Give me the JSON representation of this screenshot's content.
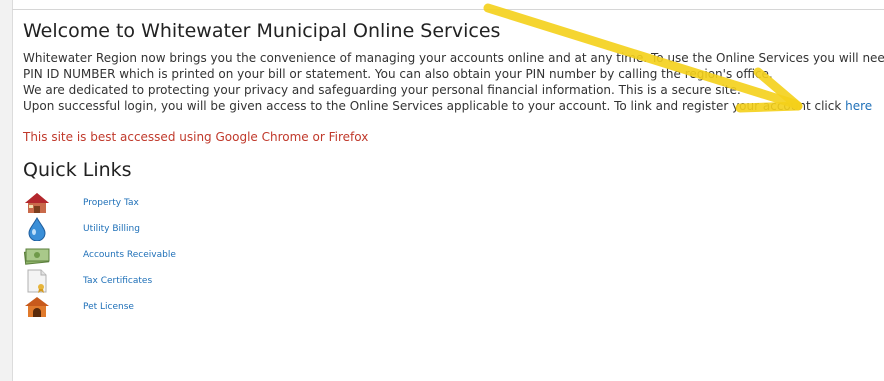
{
  "page": {
    "title": "Welcome to Whitewater Municipal Online Services",
    "intro_lines": [
      "Whitewater Region now brings you the convenience of managing your accounts online and at any time. To use the Online Services you will need your",
      "PIN ID NUMBER which is printed on your bill or statement. You can also obtain your PIN number by calling the region's office.",
      "We are dedicated to protecting your privacy and safeguarding your personal financial information. This is a secure site."
    ],
    "login_line_prefix": "Upon successful login, you will be given access to the Online Services applicable to your account. To link and register your account click ",
    "register_link": "here",
    "browser_notice": "This site is best accessed using Google Chrome or Firefox"
  },
  "quick_links": {
    "title": "Quick Links",
    "items": [
      {
        "label": "Property Tax",
        "icon": "house-icon"
      },
      {
        "label": "Utility Billing",
        "icon": "water-drop-icon"
      },
      {
        "label": "Accounts Receivable",
        "icon": "money-icon"
      },
      {
        "label": "Tax Certificates",
        "icon": "certificate-icon"
      },
      {
        "label": "Pet License",
        "icon": "doghouse-icon"
      }
    ]
  },
  "colors": {
    "link": "#1f70b8",
    "notice": "#c0392b",
    "arrow": "#f5d11a"
  }
}
